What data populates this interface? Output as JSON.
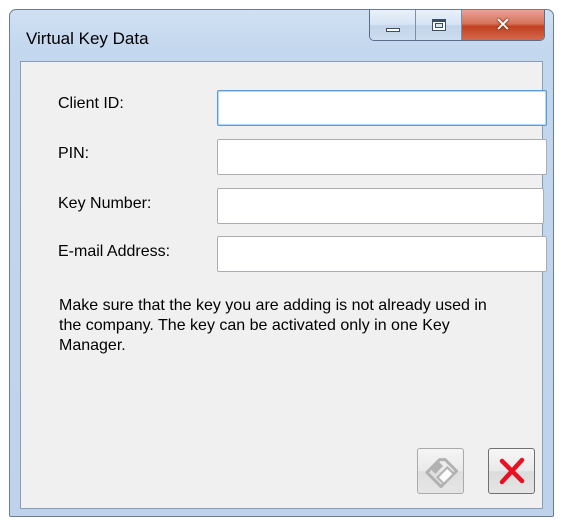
{
  "window": {
    "title": "Virtual Key Data"
  },
  "caption_buttons": {
    "minimize_icon": "minimize-icon",
    "maximize_icon": "maximize-icon",
    "close_glyph": "✕"
  },
  "form": {
    "client_id": {
      "label": "Client ID:",
      "value": ""
    },
    "pin": {
      "label": "PIN:",
      "value": ""
    },
    "key_number": {
      "label": "Key Number:",
      "value": ""
    },
    "email": {
      "label": "E-mail Address:",
      "value": ""
    }
  },
  "info": {
    "text": "Make sure that the key you are adding is not already used in the company. The key can be activated only in one Key Manager."
  },
  "actions": {
    "save_icon": "save-disk-icon",
    "save_enabled": false,
    "cancel_icon": "red-x-icon"
  },
  "colors": {
    "close_red": "#c2401f",
    "cancel_x_red": "#e81123",
    "disabled_gray": "#a8a8a8",
    "focus_blue": "#5b9bd8"
  }
}
